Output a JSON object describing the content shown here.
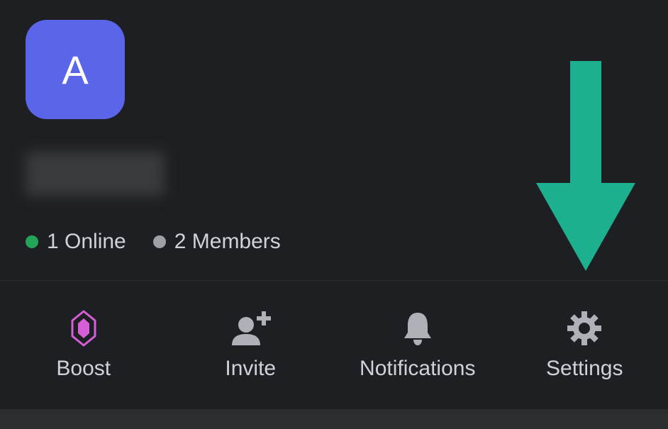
{
  "server": {
    "initial": "A",
    "online_count_label": "1 Online",
    "members_count_label": "2 Members"
  },
  "actions": {
    "boost": "Boost",
    "invite": "Invite",
    "notifications": "Notifications",
    "settings": "Settings"
  },
  "colors": {
    "server_icon": "#5a65ea",
    "arrow": "#1cb08f",
    "online_dot": "#23a559"
  }
}
